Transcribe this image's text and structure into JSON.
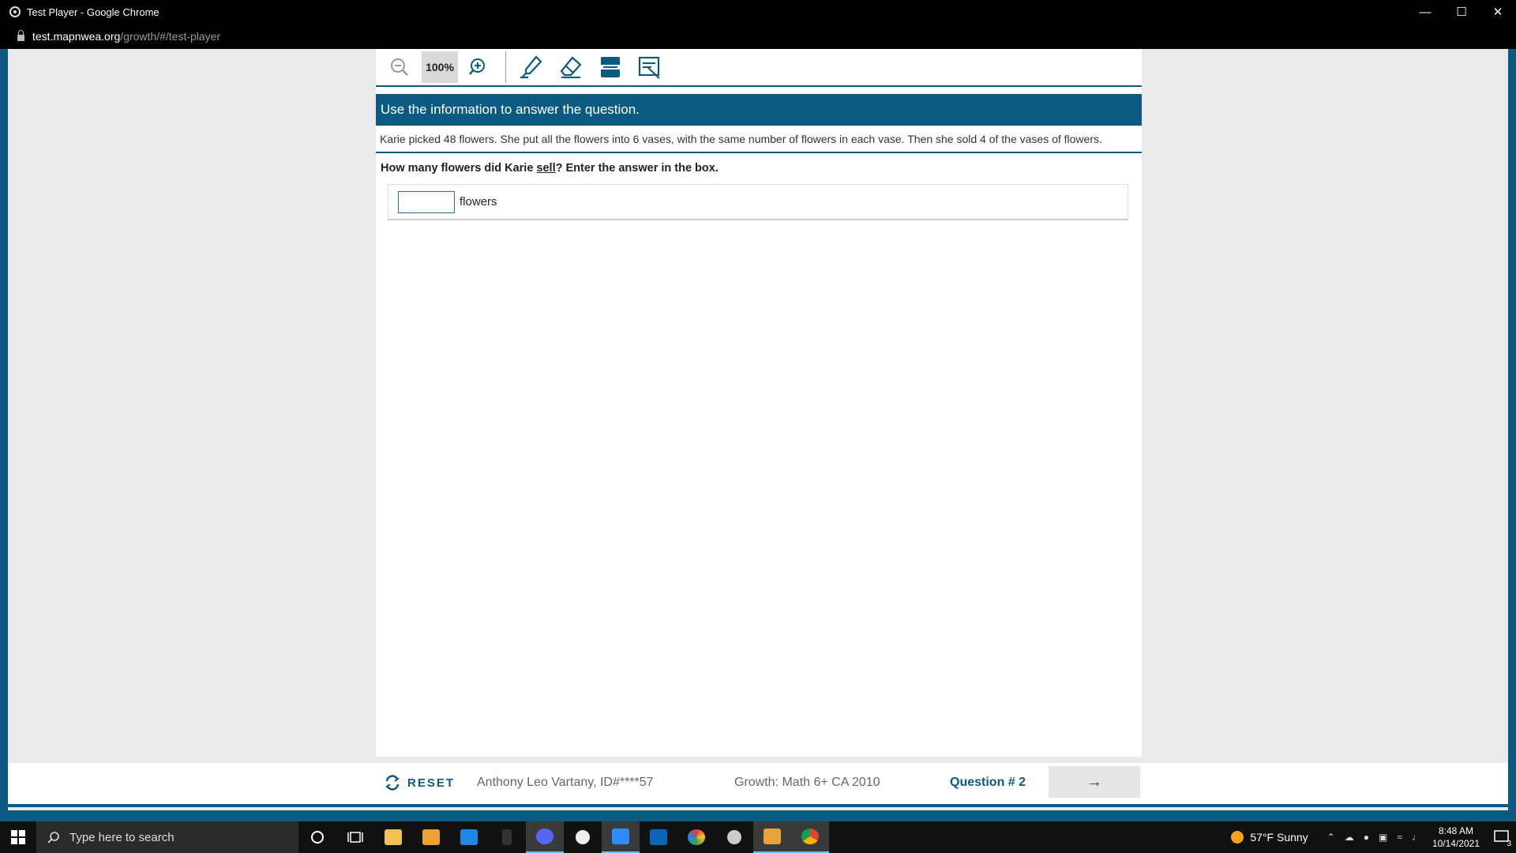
{
  "window": {
    "title": "Test Player - Google Chrome",
    "url_host": "test.mapnwea.org",
    "url_path": "/growth/#/test-player"
  },
  "toolbar": {
    "zoom_level": "100%",
    "tools": [
      "zoom-out-icon",
      "zoom-in-icon",
      "highlighter-icon",
      "eraser-icon",
      "line-reader-icon",
      "answer-eliminator-icon"
    ]
  },
  "item": {
    "instruction": "Use the information to answer the question.",
    "passage": "Karie picked 48 flowers. She put all the flowers into 6 vases, with the same number of flowers in each vase. Then she sold 4 of the vases of flowers.",
    "question_before": "How many flowers did Karie ",
    "question_keyword": "sell",
    "question_after": "? Enter the answer in the box.",
    "answer_value": "",
    "answer_unit": "flowers"
  },
  "footer": {
    "reset_label": "RESET",
    "student": "Anthony Leo Vartany, ID#****57",
    "test_name": "Growth: Math 6+ CA 2010",
    "question_number": "Question # 2",
    "next_arrow": "→"
  },
  "taskbar": {
    "search_placeholder": "Type here to search",
    "weather": "57°F  Sunny",
    "time": "8:48 AM",
    "date": "10/14/2021",
    "notification_count": "3"
  },
  "colors": {
    "brand_blue": "#0b5a82",
    "input_border": "#2a6fa0"
  }
}
